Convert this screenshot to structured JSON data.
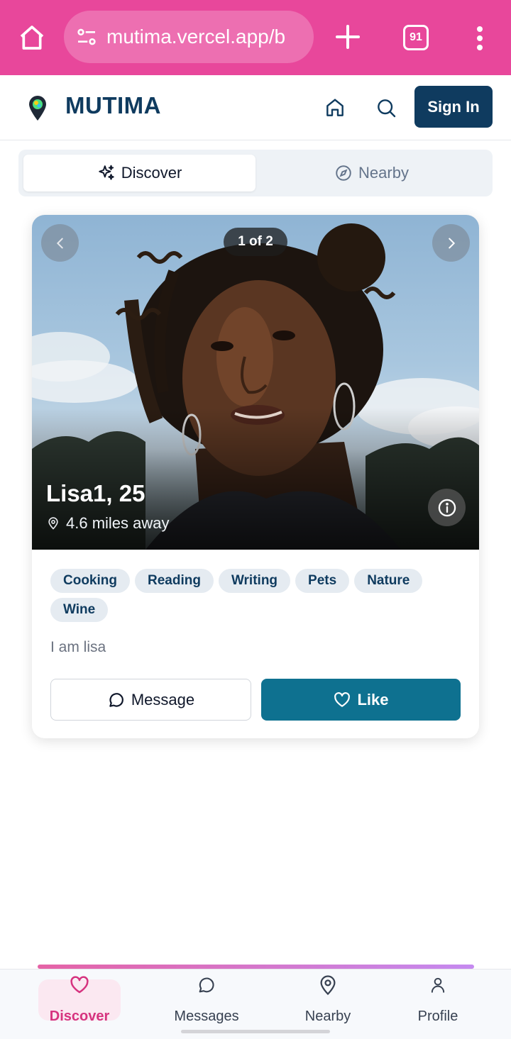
{
  "browser": {
    "url": "mutima.vercel.app/b",
    "tab_count": "91"
  },
  "header": {
    "brand": "MUTIMA",
    "signin_label": "Sign In"
  },
  "tabs": [
    {
      "label": "Discover",
      "active": true,
      "icon": "sparkles-icon"
    },
    {
      "label": "Nearby",
      "active": false,
      "icon": "compass-icon"
    }
  ],
  "profile": {
    "counter": "1 of 2",
    "name_age": "Lisa1, 25",
    "distance": "4.6 miles away",
    "interests": [
      "Cooking",
      "Reading",
      "Writing",
      "Pets",
      "Nature",
      "Wine"
    ],
    "bio": "I am lisa",
    "message_label": "Message",
    "like_label": "Like"
  },
  "bottom_nav": [
    {
      "label": "Discover",
      "icon": "heart-icon",
      "active": true
    },
    {
      "label": "Messages",
      "icon": "chat-icon",
      "active": false
    },
    {
      "label": "Nearby",
      "icon": "map-pin-icon",
      "active": false
    },
    {
      "label": "Profile",
      "icon": "user-icon",
      "active": false
    }
  ],
  "colors": {
    "browser_bar": "#e8479b",
    "brand": "#0f3b5f",
    "like_button": "#0e7190",
    "active_nav": "#d6337f"
  }
}
